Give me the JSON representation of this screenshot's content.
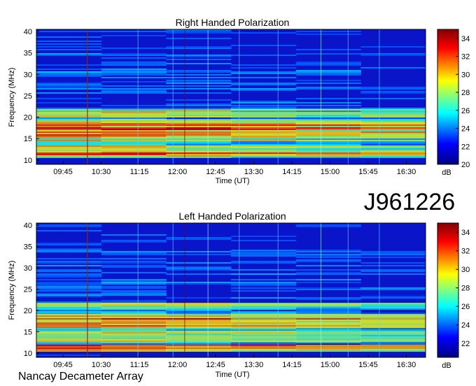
{
  "observation_id": "J961226",
  "footer": "Nancay Decameter Array",
  "chart_data": [
    {
      "type": "heatmap",
      "title": "Right Handed Polarization",
      "xlabel": "Time (UT)",
      "ylabel": "Frequency (MHz)",
      "x_ticks": [
        "09:45",
        "10:30",
        "11:15",
        "12:00",
        "12:45",
        "13:30",
        "14:15",
        "15:00",
        "15:45",
        "16:30"
      ],
      "y_ticks": [
        10,
        15,
        20,
        25,
        30,
        35,
        40
      ],
      "ylim": [
        9,
        40.5
      ],
      "colorbar": {
        "label": "dB",
        "ticks": [
          20,
          22,
          24,
          26,
          28,
          30,
          32,
          34
        ],
        "range": [
          20,
          35
        ]
      },
      "colormap": [
        "#000080",
        "#0000ff",
        "#00ffff",
        "#ffff00",
        "#ff0000",
        "#800000"
      ]
    },
    {
      "type": "heatmap",
      "title": "Left Handed Polarization",
      "xlabel": "Time (UT)",
      "ylabel": "Frequency (MHz)",
      "x_ticks": [
        "09:45",
        "10:30",
        "11:15",
        "12:00",
        "12:45",
        "13:30",
        "14:15",
        "15:00",
        "15:45",
        "16:30"
      ],
      "y_ticks": [
        10,
        15,
        20,
        25,
        30,
        35,
        40
      ],
      "ylim": [
        9,
        40.5
      ],
      "colorbar": {
        "label": "dB",
        "ticks": [
          22,
          24,
          26,
          28,
          30,
          32,
          34
        ],
        "range": [
          20.5,
          35
        ]
      },
      "colormap": [
        "#000080",
        "#0000ff",
        "#00ffff",
        "#ffff00",
        "#ff0000",
        "#800000"
      ]
    }
  ]
}
